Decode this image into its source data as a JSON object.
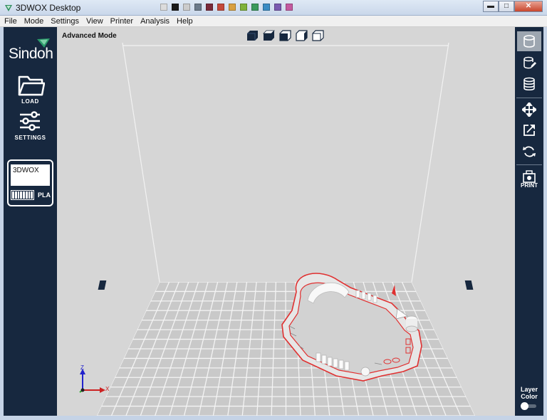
{
  "window": {
    "title": "3DWOX Desktop",
    "swatch_colors": [
      "#dcdcdc",
      "#1a1a1a",
      "#cccccc",
      "#6b7a8a",
      "#7a2a3a",
      "#c4493b",
      "#d9a040",
      "#7fb23a",
      "#3a9a5c",
      "#3a8cc4",
      "#7a5ab0",
      "#c45aa0"
    ],
    "minimize": "▬",
    "maximize": "□",
    "close": "✕"
  },
  "menu": [
    "File",
    "Mode",
    "Settings",
    "View",
    "Printer",
    "Analysis",
    "Help"
  ],
  "sidebar": {
    "logo": "Sindoh",
    "load_label": "LOAD",
    "settings_label": "SETTINGS",
    "printer_card": {
      "name": "3DWOX",
      "material": "PLA"
    }
  },
  "viewport": {
    "mode_label": "Advanced Mode",
    "view_buttons": [
      "view-front",
      "view-top",
      "view-left",
      "view-right",
      "view-back"
    ],
    "axes": {
      "z": "Z",
      "x": "X"
    }
  },
  "toolbar": {
    "tools": [
      "cylinder-icon",
      "edit-layer-icon",
      "layers-icon",
      "move-icon",
      "scale-icon",
      "rotate-icon",
      "print-icon"
    ],
    "active_tool": "cylinder-icon",
    "print_label": "PRINT",
    "layer_color_label": "Layer Color",
    "layer_color_enabled": false
  },
  "colors": {
    "sidebar": "#17283f",
    "viewport": "#d6d6d6",
    "model_outline": "#e03030",
    "model": "#f5f5f5"
  }
}
